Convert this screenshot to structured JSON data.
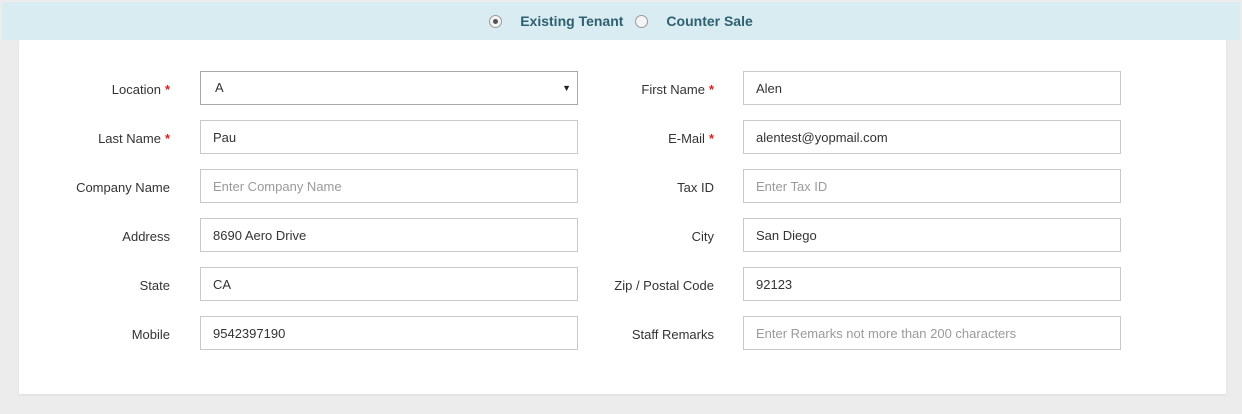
{
  "customer_type": {
    "options": [
      {
        "label": "Existing Tenant",
        "selected": true
      },
      {
        "label": "Counter Sale",
        "selected": false
      }
    ]
  },
  "form": {
    "location": {
      "label": "Location",
      "required": "*",
      "value": "A"
    },
    "first_name": {
      "label": "First Name",
      "required": "*",
      "value": "Alen"
    },
    "last_name": {
      "label": "Last Name",
      "required": "*",
      "value": "Pau"
    },
    "email": {
      "label": "E-Mail",
      "required": "*",
      "value": "alentest@yopmail.com"
    },
    "company_name": {
      "label": "Company Name",
      "placeholder": "Enter Company Name",
      "value": ""
    },
    "tax_id": {
      "label": "Tax ID",
      "placeholder": "Enter Tax ID",
      "value": ""
    },
    "address": {
      "label": "Address",
      "value": "8690 Aero Drive"
    },
    "city": {
      "label": "City",
      "value": "San Diego"
    },
    "state": {
      "label": "State",
      "value": "CA"
    },
    "zip": {
      "label": "Zip / Postal Code",
      "value": "92123"
    },
    "mobile": {
      "label": "Mobile",
      "value": "9542397190"
    },
    "staff_remarks": {
      "label": "Staff Remarks",
      "placeholder": "Enter Remarks not more than 200 characters",
      "value": ""
    }
  },
  "colors": {
    "required": "#d9221c",
    "header_bg": "#d8ecf2",
    "header_text": "#2e6070"
  }
}
